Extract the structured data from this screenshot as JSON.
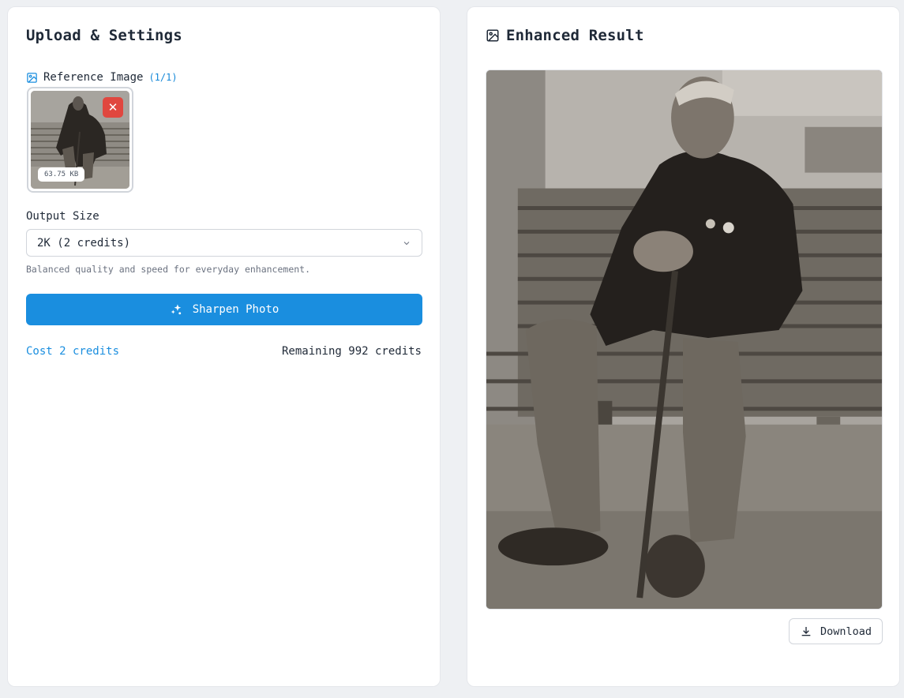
{
  "left_panel": {
    "title": "Upload & Settings",
    "reference": {
      "label": "Reference Image",
      "count": "(1/1)",
      "file_size": "63.75 KB",
      "remove_symbol": "✕"
    },
    "output_size": {
      "label": "Output Size",
      "selected": "2K (2 credits)",
      "helper": "Balanced quality and speed for everyday enhancement."
    },
    "primary_button": "Sharpen Photo",
    "cost": "Cost 2 credits",
    "remaining": "Remaining 992 credits"
  },
  "right_panel": {
    "title": "Enhanced Result",
    "download_label": "Download"
  },
  "icons": {
    "image": "image-icon",
    "sparkle": "sparkle-icon",
    "download": "download-icon",
    "chevron": "chevron-down-icon",
    "close": "close-icon"
  },
  "colors": {
    "accent": "#1a8edf",
    "danger": "#e0473f",
    "background": "#eef0f3"
  }
}
